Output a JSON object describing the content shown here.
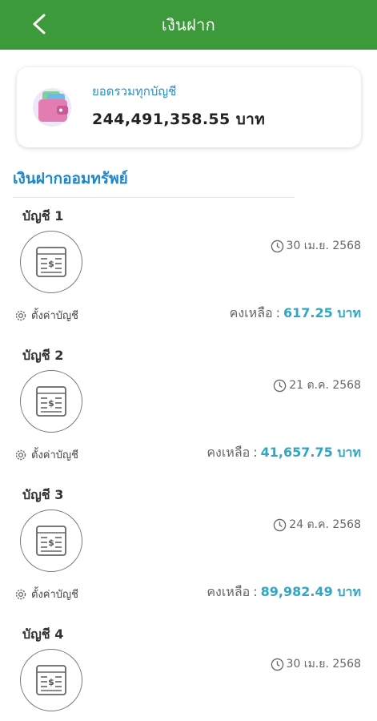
{
  "header": {
    "title": "เงินฝาก",
    "back_icon": "chevron-left-icon"
  },
  "summary": {
    "label": "ยอดรวมทุกบัญชี",
    "amount": "244,491,358.55 บาท",
    "icon": "wallet-icon"
  },
  "section": {
    "title": "เงินฝากออมทรัพย์"
  },
  "accounts": [
    {
      "name": "บัญชี 1",
      "date": "30 เม.ย. 2568",
      "settings_label": "ตั้งค่าบัญชี",
      "balance_label": "คงเหลือ",
      "separator": ":",
      "balance": "617.25 บาท"
    },
    {
      "name": "บัญชี 2",
      "date": "21 ต.ค. 2568",
      "settings_label": "ตั้งค่าบัญชี",
      "balance_label": "คงเหลือ",
      "separator": ":",
      "balance": "41,657.75 บาท"
    },
    {
      "name": "บัญชี 3",
      "date": "24 ต.ค. 2568",
      "settings_label": "ตั้งค่าบัญชี",
      "balance_label": "คงเหลือ",
      "separator": ":",
      "balance": "89,982.49 บาท"
    },
    {
      "name": "บัญชี 4",
      "date": "30 เม.ย. 2568"
    }
  ],
  "colors": {
    "header_bg": "#3d9a3a",
    "accent_blue": "#1f86c9",
    "balance_teal": "#2fa7c4"
  }
}
